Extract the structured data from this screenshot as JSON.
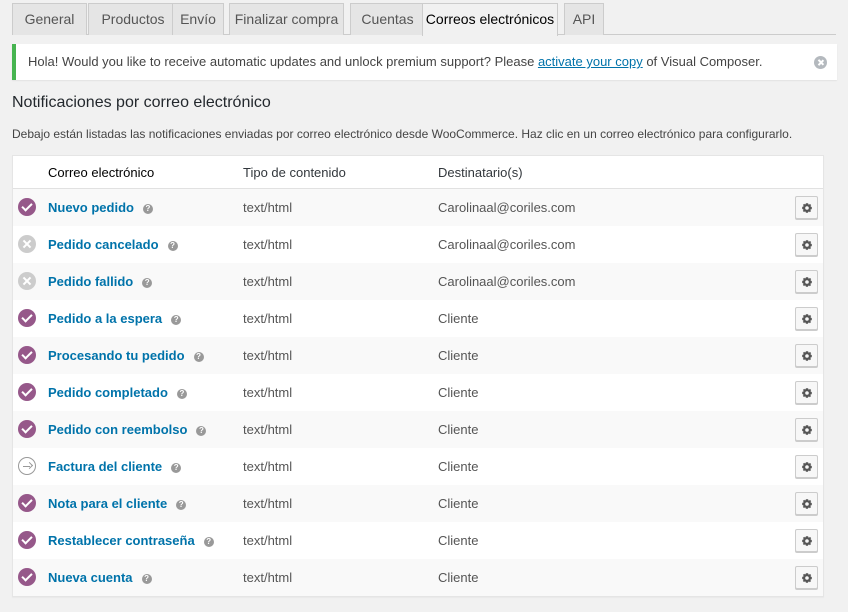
{
  "tabs": [
    {
      "label": "General",
      "active": false
    },
    {
      "label": "Productos",
      "active": false
    },
    {
      "label": "Envío",
      "active": false
    },
    {
      "label": "Finalizar compra",
      "active": false
    },
    {
      "label": "Cuentas",
      "active": false
    },
    {
      "label": "Correos electrónicos",
      "active": true
    },
    {
      "label": "API",
      "active": false
    }
  ],
  "notice": {
    "text_before": "Hola! Would you like to receive automatic updates and unlock premium support? Please ",
    "link": "activate your copy",
    "text_after": " of Visual Composer."
  },
  "page": {
    "title": "Notificaciones por correo electrónico",
    "description": "Debajo están listadas las notificaciones enviadas por correo electrónico desde WooCommerce. Haz clic en un correo electrónico para configurarlo."
  },
  "table": {
    "headers": {
      "name": "Correo electrónico",
      "type": "Tipo de contenido",
      "recipient": "Destinatario(s)"
    },
    "rows": [
      {
        "status": "on",
        "name": "Nuevo pedido",
        "type": "text/html",
        "recipient": "Carolinaal@coriles.com"
      },
      {
        "status": "off",
        "name": "Pedido cancelado",
        "type": "text/html",
        "recipient": "Carolinaal@coriles.com"
      },
      {
        "status": "off",
        "name": "Pedido fallido",
        "type": "text/html",
        "recipient": "Carolinaal@coriles.com"
      },
      {
        "status": "on",
        "name": "Pedido a la espera",
        "type": "text/html",
        "recipient": "Cliente"
      },
      {
        "status": "on",
        "name": "Procesando tu pedido",
        "type": "text/html",
        "recipient": "Cliente"
      },
      {
        "status": "on",
        "name": "Pedido completado",
        "type": "text/html",
        "recipient": "Cliente"
      },
      {
        "status": "on",
        "name": "Pedido con reembolso",
        "type": "text/html",
        "recipient": "Cliente"
      },
      {
        "status": "manual",
        "name": "Factura del cliente",
        "type": "text/html",
        "recipient": "Cliente"
      },
      {
        "status": "on",
        "name": "Nota para el cliente",
        "type": "text/html",
        "recipient": "Cliente"
      },
      {
        "status": "on",
        "name": "Restablecer contraseña",
        "type": "text/html",
        "recipient": "Cliente"
      },
      {
        "status": "on",
        "name": "Nueva cuenta",
        "type": "text/html",
        "recipient": "Cliente"
      }
    ]
  },
  "icons": {
    "status_on": "check-circle-icon",
    "status_off": "x-circle-icon",
    "status_manual": "arrow-circle-icon",
    "help": "help-icon",
    "configure": "gear-icon",
    "dismiss": "dismiss-icon"
  },
  "colors": {
    "accent_purple": "#96588a",
    "link_blue": "#0073aa",
    "notice_green": "#46b450"
  }
}
